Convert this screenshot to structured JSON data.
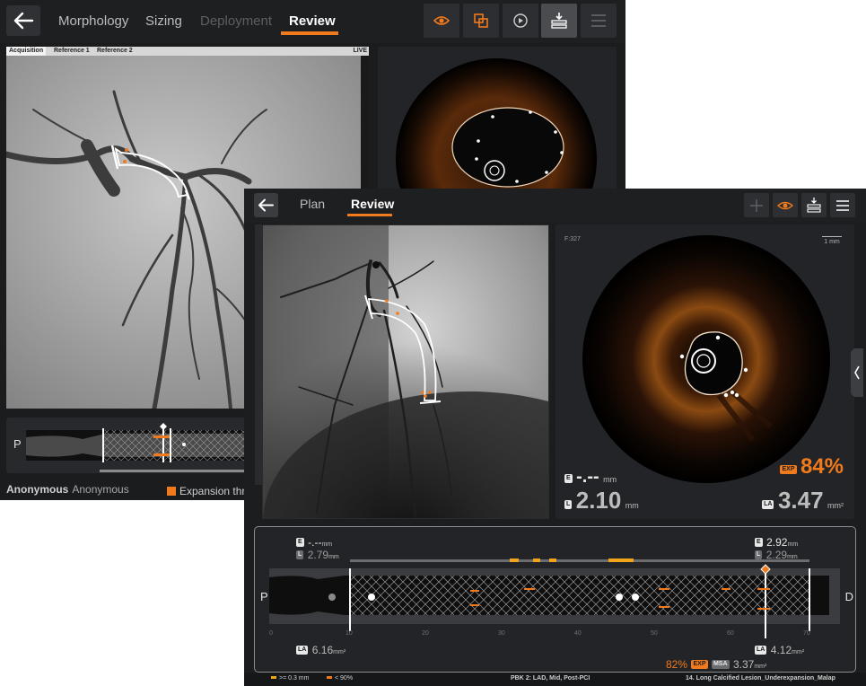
{
  "back_window": {
    "tabs": [
      "Morphology",
      "Sizing",
      "Deployment",
      "Review"
    ],
    "active_tab": "Review",
    "angio_tabs": [
      "Acquisition",
      "Reference 1",
      "Reference 2"
    ],
    "live_label": "LIVE",
    "long_view": {
      "proximal_label": "P"
    },
    "patient": {
      "label": "Anonymous",
      "name": "Anonymous"
    },
    "legend": {
      "expansion_label": "Expansion thre"
    },
    "toolbar_icons": [
      "eye-icon",
      "overlay-icon",
      "play-icon",
      "layers-download-icon",
      "menu-icon"
    ]
  },
  "front_window": {
    "tabs": [
      "Plan",
      "Review"
    ],
    "active_tab": "Review",
    "toolbar_icons": [
      "plus-icon",
      "eye-icon",
      "layers-download-icon",
      "menu-icon"
    ],
    "oct": {
      "frame": "F:327",
      "scale": "1 mm",
      "ext_value": "-.--",
      "ext_unit": "mm",
      "lumen_diameter": "2.10",
      "lumen_unit": "mm",
      "expansion_tag": "EXP",
      "expansion_pct": "84%",
      "lumen_area": "3.47",
      "area_unit": "mm²"
    },
    "long_view": {
      "proximal_label": "P",
      "distal_label": "D",
      "left_ext_value": "-.--",
      "left_ext_unit": "mm",
      "left_lumen_value": "2.79",
      "left_lumen_unit": "mm",
      "right_ext_value": "2.92",
      "right_ext_unit": "mm",
      "right_lumen_value": "2.29",
      "right_lumen_unit": "mm",
      "left_area": "6.16",
      "right_area": "4.12",
      "area_unit": "mm²",
      "msa_pct": "82%",
      "exp_tag": "EXP",
      "msa_tag": "MSA",
      "msa_value": "3.37",
      "msa_unit": "mm²",
      "axis_ticks": [
        "0",
        "10",
        "20",
        "30",
        "40",
        "50",
        "60",
        "70"
      ]
    },
    "status_bar": {
      "legend_1": ">= 0.3 mm",
      "legend_2": "< 90%",
      "pullback": "PBK 2:  LAD,  Mid,  Post-PCI",
      "case": "14.  Long Calcified Lesion_Underexpansion_Malap"
    }
  },
  "colors": {
    "accent": "#f07a1c",
    "background": "#1c1d1f",
    "panel": "#232427"
  }
}
